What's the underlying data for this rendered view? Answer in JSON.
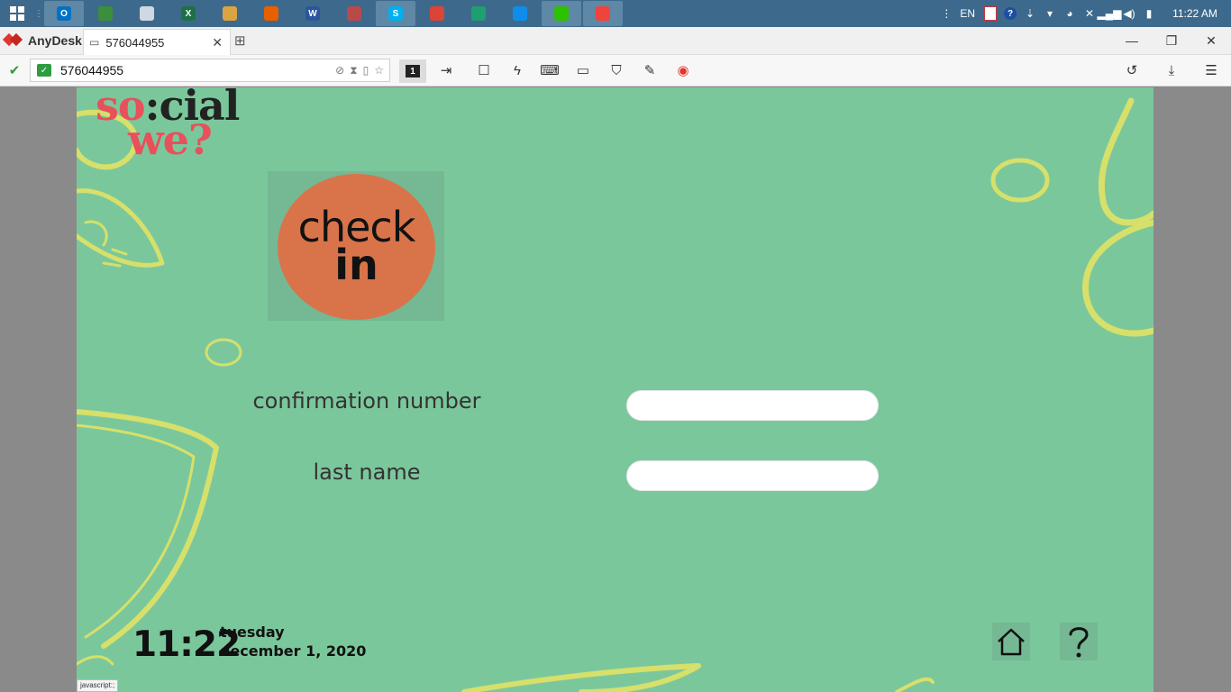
{
  "taskbar": {
    "apps": [
      {
        "name": "outlook",
        "letter": "O",
        "color": "#0072c6",
        "active": true
      },
      {
        "name": "app-green",
        "letter": "",
        "color": "#3b8f3b",
        "active": false
      },
      {
        "name": "calculator",
        "letter": "",
        "color": "#cfd8e3",
        "active": false
      },
      {
        "name": "excel",
        "letter": "X",
        "color": "#1e7145",
        "active": false
      },
      {
        "name": "app-yellow",
        "letter": "",
        "color": "#d9a441",
        "active": false
      },
      {
        "name": "firefox",
        "letter": "",
        "color": "#e66000",
        "active": false
      },
      {
        "name": "word",
        "letter": "W",
        "color": "#2b579a",
        "active": false
      },
      {
        "name": "app-red",
        "letter": "",
        "color": "#b84a4a",
        "active": false
      },
      {
        "name": "skype",
        "letter": "S",
        "color": "#00aff0",
        "active": true
      },
      {
        "name": "chrome",
        "letter": "",
        "color": "#db4437",
        "active": false
      },
      {
        "name": "shield",
        "letter": "",
        "color": "#1f9e6f",
        "active": false
      },
      {
        "name": "teamviewer",
        "letter": "",
        "color": "#0e8ee9",
        "active": false
      },
      {
        "name": "wechat",
        "letter": "",
        "color": "#2dc100",
        "active": true
      },
      {
        "name": "anydesk",
        "letter": "",
        "color": "#ef443b",
        "active": true
      }
    ],
    "language": "EN",
    "time": "11:22 AM"
  },
  "anydesk": {
    "brand": "AnyDesk",
    "tab_title": "576044955",
    "address": "576044955",
    "monitor_number": "1"
  },
  "screen": {
    "logo_so": "so",
    "logo_colon": ":",
    "logo_cial": "cial",
    "logo_we": "we?",
    "checkin_line1": "check",
    "checkin_line2": "in",
    "confirmation_label": "confirmation number",
    "confirmation_value": "",
    "lastname_label": "last name",
    "lastname_value": "",
    "clock": "11:22",
    "weekday": "tuesday",
    "date": "december 1, 2020",
    "status_tip": "javascript:;"
  },
  "colors": {
    "background": "#7bc79c",
    "accent_red": "#e8505b",
    "checkin_orange": "#d9744a",
    "doodle": "#d6e06a"
  }
}
